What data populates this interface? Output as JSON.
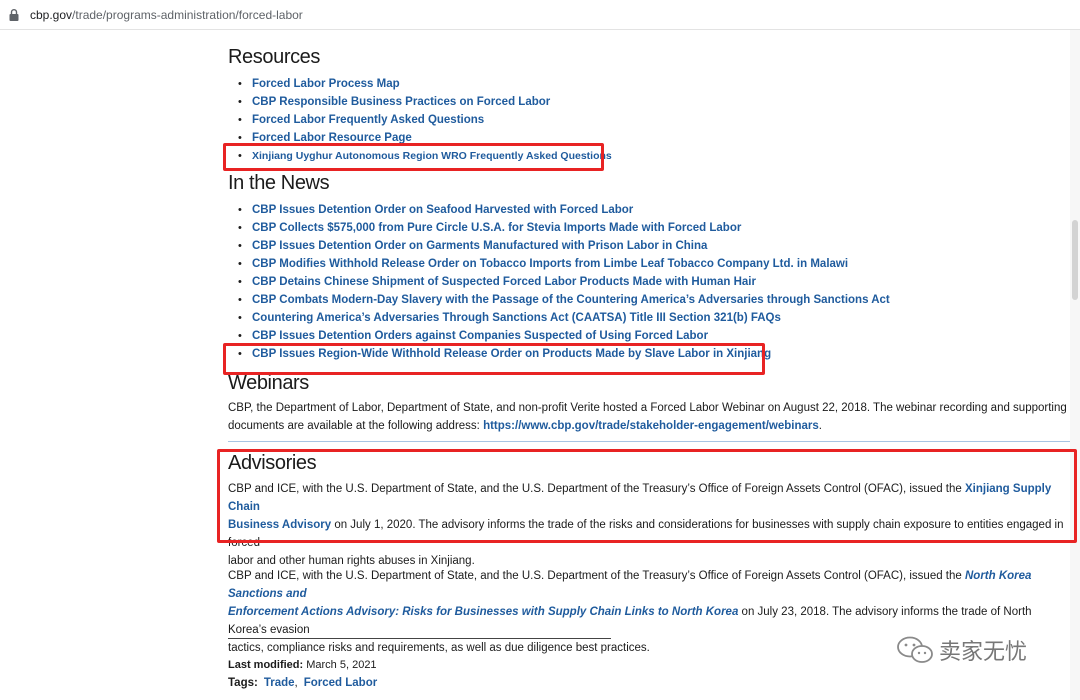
{
  "browser": {
    "url_domain": "cbp.gov",
    "url_path": "/trade/programs-administration/forced-labor"
  },
  "resources": {
    "heading": "Resources",
    "links": [
      "Forced Labor Process Map",
      "CBP Responsible Business Practices on Forced Labor",
      "Forced Labor Frequently Asked Questions",
      "Forced Labor Resource Page",
      "Xinjiang Uyghur Autonomous Region WRO Frequently Asked Questions"
    ]
  },
  "news": {
    "heading": "In the News",
    "links": [
      "CBP Issues Detention Order on Seafood Harvested with Forced Labor",
      "CBP Collects $575,000 from Pure Circle U.S.A. for Stevia Imports Made with Forced Labor",
      "CBP Issues Detention Order on Garments Manufactured with Prison Labor in China",
      "CBP Modifies Withhold Release Order on Tobacco Imports from Limbe Leaf Tobacco Company Ltd. in Malawi",
      "CBP Detains Chinese Shipment of Suspected Forced Labor Products Made with Human Hair",
      "CBP Combats Modern-Day Slavery with the Passage of the Countering America’s Adversaries through Sanctions Act",
      "Countering America’s Adversaries Through Sanctions Act (CAATSA) Title III Section 321(b) FAQs",
      "CBP Issues Detention Orders against Companies Suspected of Using Forced Labor",
      "CBP Issues Region-Wide Withhold Release Order on Products Made by Slave Labor in Xinjiang"
    ]
  },
  "webinars": {
    "heading": "Webinars",
    "text_1": "CBP, the Department of Labor, Department of State, and non-profit Verite hosted a Forced Labor Webinar on August 22, 2018.  The webinar recording and supporting",
    "text_2": "documents are  available at the following address: ",
    "link": "https://www.cbp.gov/trade/stakeholder-engagement/webinars",
    "text_end": "."
  },
  "advisories": {
    "heading": "Advisories",
    "p1_line1_pre": "CBP and ICE, with the U.S. Department of State, and the U.S. Department of the Treasury’s Office of Foreign Assets Control (OFAC), issued the ",
    "p1_link_a": "Xinjiang Supply Chain",
    "p1_link_b": "Business Advisory",
    "p1_line2_post": " on July 1, 2020. The advisory informs the trade of the risks and considerations for businesses with supply chain exposure to entities engaged in forced",
    "p1_line3": "labor and other human rights abuses in Xinjiang.",
    "p2_line1_pre": "CBP and ICE, with the U.S. Department of State, and the U.S. Department of the Treasury’s Office of Foreign Assets Control (OFAC), issued the ",
    "p2_link_a": "North Korea Sanctions and",
    "p2_link_b": "Enforcement Actions Advisory: Risks for Businesses with Supply Chain Links to North Korea",
    "p2_line2_post": " on July 23, 2018.  The advisory informs the trade of North Korea’s evasion",
    "p2_line3": "tactics, compliance risks and requirements, as well as due diligence best practices."
  },
  "footer": {
    "last_modified_label": "Last modified:",
    "last_modified_value": "March 5, 2021",
    "tags_label": "Tags:",
    "tags": [
      "Trade",
      "Forced Labor"
    ]
  },
  "watermark": {
    "text": "卖家无忧"
  },
  "colors": {
    "link": "#1f5b9d",
    "highlight": "#e82323",
    "divider": "#a9c5e3"
  }
}
